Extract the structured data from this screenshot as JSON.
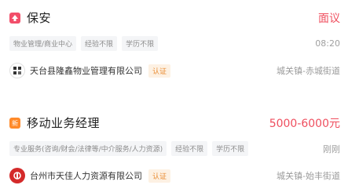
{
  "jobs": [
    {
      "title": "保安",
      "salary": "面议",
      "tags": [
        "物业管理/商业中心",
        "经验不限",
        "学历不限"
      ],
      "time": "08:20",
      "company": "天台县隆鑫物业管理有限公司",
      "verified": "认证",
      "location": "城关镇-赤城街道",
      "icon": "hot-icon",
      "icon_color": "#f24e6a"
    },
    {
      "title": "移动业务经理",
      "salary": "5000-6000元",
      "tags": [
        "专业服务(咨询/财会/法律等/中介服务/人力资源)",
        "经验不限",
        "学历不限"
      ],
      "time": "刚刚",
      "company": "台州市天佳人力资源有限公司",
      "verified": "认证",
      "location": "城关镇-始丰街道",
      "icon": "new-icon",
      "icon_color": "#ff8a2a"
    }
  ]
}
